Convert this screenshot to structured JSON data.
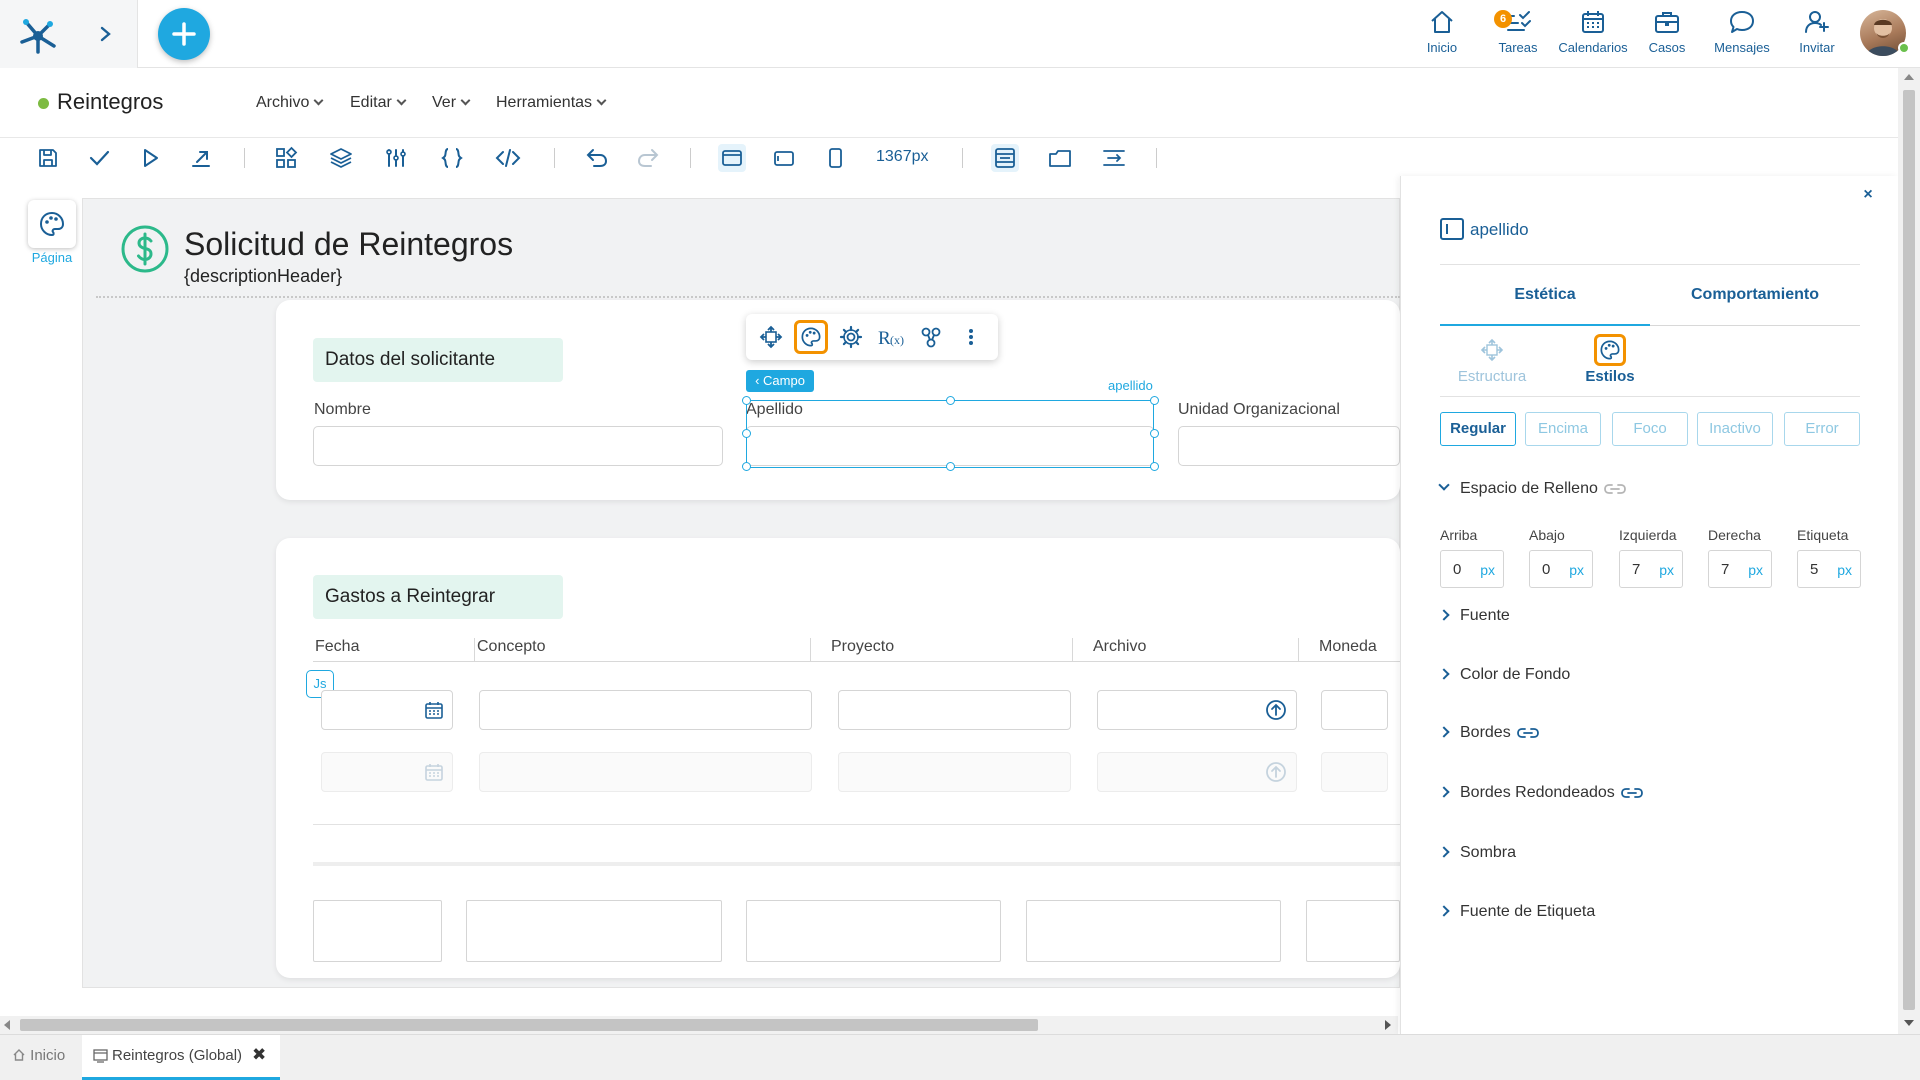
{
  "topnav": {
    "items": [
      {
        "label": "Inicio",
        "icon": "home-icon"
      },
      {
        "label": "Tareas",
        "icon": "tasks-icon",
        "badge": "6"
      },
      {
        "label": "Calendarios",
        "icon": "calendar-icon"
      },
      {
        "label": "Casos",
        "icon": "briefcase-icon"
      },
      {
        "label": "Mensajes",
        "icon": "chat-icon"
      },
      {
        "label": "Invitar",
        "icon": "add-user-icon"
      }
    ]
  },
  "menubar": {
    "title": "Reintegros",
    "menus": [
      "Archivo",
      "Editar",
      "Ver",
      "Herramientas"
    ]
  },
  "toolbar": {
    "width_label": "1367px"
  },
  "page_tool": {
    "label": "Página"
  },
  "form": {
    "title": "Solicitud de Reintegros",
    "subtitle": "{descriptionHeader}",
    "section1": {
      "title": "Datos del solicitante",
      "fields": [
        "Nombre",
        "Apellido",
        "Unidad Organizacional"
      ]
    },
    "selection": {
      "tag": "Campo",
      "field_id": "apellido"
    },
    "section2": {
      "title": "Gastos a Reintegrar",
      "columns": [
        "Fecha",
        "Concepto",
        "Proyecto",
        "Archivo",
        "Moneda"
      ],
      "js_label": "Js"
    }
  },
  "panel": {
    "field_name": "apellido",
    "tabs": [
      "Estética",
      "Comportamiento"
    ],
    "subtabs": [
      "Estructura",
      "Estilos"
    ],
    "states": [
      "Regular",
      "Encima",
      "Foco",
      "Inactivo",
      "Error"
    ],
    "sections": {
      "padding": "Espacio de Relleno",
      "font": "Fuente",
      "bg": "Color de Fondo",
      "borders": "Bordes",
      "radius": "Bordes Redondeados",
      "shadow": "Sombra",
      "label_font": "Fuente de Etiqueta"
    },
    "padding_fields": [
      {
        "label": "Arriba",
        "value": "0",
        "unit": "px"
      },
      {
        "label": "Abajo",
        "value": "0",
        "unit": "px"
      },
      {
        "label": "Izquierda",
        "value": "7",
        "unit": "px"
      },
      {
        "label": "Derecha",
        "value": "7",
        "unit": "px"
      },
      {
        "label": "Etiqueta",
        "value": "5",
        "unit": "px"
      }
    ],
    "close_glyph": "×"
  },
  "bottom_tabs": {
    "home": "Inicio",
    "active": "Reintegros (Global)",
    "close_glyph": "✖"
  },
  "colors": {
    "accent": "#1fa8e0",
    "navy": "#1a5f96",
    "highlight": "#f39200",
    "section_bg": "#e3f5ef",
    "status_green": "#7dbb42"
  }
}
